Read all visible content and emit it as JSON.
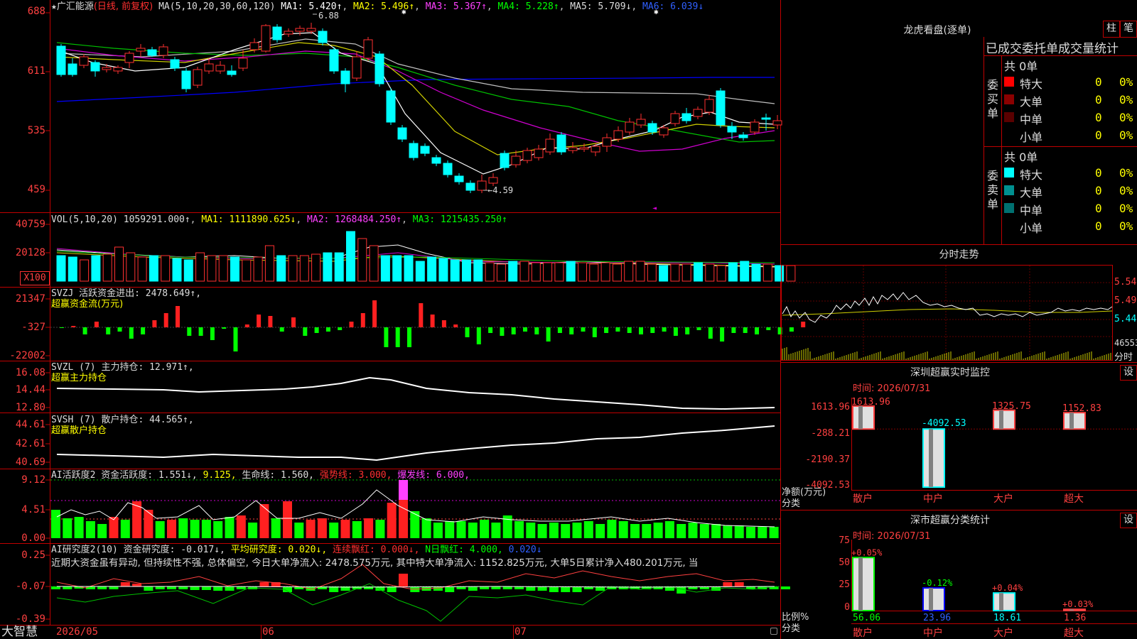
{
  "stock": {
    "star": "★",
    "name": "广汇能源",
    "period": "(日线, 前复权)",
    "ma_label": "MA(5,10,20,30,60,120)",
    "ma1": "MA1: 5.420↑",
    "ma2": "MA2: 5.496↑",
    "ma3": "MA3: 5.367↑",
    "ma4": "MA4: 5.228↑",
    "ma5": "MA5: 5.709↓",
    "ma6": "MA6: 6.039↓",
    "high_marker": "6.88",
    "low_marker": "←4.59"
  },
  "price_axis": [
    "688",
    "611",
    "535",
    "459"
  ],
  "volume": {
    "label": "VOL(5,10,20)",
    "value": "1059291.000↑",
    "ma1": "MA1: 1111890.625↓",
    "ma2": "MA2: 1268484.250↑",
    "ma3": "MA3: 1215435.250↑",
    "axis": [
      "40759",
      "20128"
    ],
    "unit": "X100"
  },
  "svzj": {
    "label": "SVZJ  活跃资金进出: 2478.649↑,",
    "sub": "超赢资金流(万元)",
    "axis": [
      "21347",
      "-327",
      "-22002"
    ]
  },
  "svzl": {
    "label": "SVZL (7) 主力持仓: 12.971↑,",
    "sub": "超赢主力持仓",
    "axis": [
      "16.08",
      "14.44",
      "12.80"
    ]
  },
  "svsh": {
    "label": "SVSH (7) 散户持仓: 44.565↑,",
    "sub": "超赢散户持仓",
    "axis": [
      "44.61",
      "42.61",
      "40.69"
    ]
  },
  "ai_active": {
    "label": "AI活跃度2 资金活跃度: 1.551↓,",
    "v2": "9.125,",
    "life": "生命线: 1.560,",
    "strong": "强势线: 3.000,",
    "burst": "爆发线: 6.000,",
    "axis": [
      "9.12",
      "4.51",
      "0.00"
    ]
  },
  "ai_research": {
    "label": "AI研究度2(10) 资金研究度: -0.017↓,",
    "avg": "平均研究度: 0.020↓,",
    "red": "连续飘红: 0.000↓,",
    "nday": "N日飘红: 4.000,",
    "nval": "0.020↓",
    "comment": "近期大资金虽有异动, 但持续性不强, 总体偏空, 今日大单净流入: 2478.575万元, 其中特大单净流入: 1152.825万元, 大单5日累计净入480.201万元, 当",
    "axis": [
      "0.25",
      "-0.07",
      "-0.39"
    ]
  },
  "bottom": {
    "brand": "大智慧",
    "dates": [
      "2026/05",
      "06",
      "07"
    ]
  },
  "longhu": {
    "title": "龙虎看盘(逐单)",
    "btn_bar": "柱",
    "btn_bi": "笔",
    "header": "已成交委托单成交量统计",
    "buy_label": "委买单",
    "sell_label": "委卖单",
    "buy_total": "共 0单",
    "sell_total": "共 0单",
    "buy_rows": [
      {
        "name": "特大",
        "count": "0",
        "pct": "0%",
        "color": "#ff0000"
      },
      {
        "name": "大单",
        "count": "0",
        "pct": "0%",
        "color": "#8b0000"
      },
      {
        "name": "中单",
        "count": "0",
        "pct": "0%",
        "color": "#5a0000"
      },
      {
        "name": "小单",
        "count": "0",
        "pct": "0%",
        "color": ""
      }
    ],
    "sell_rows": [
      {
        "name": "特大",
        "count": "0",
        "pct": "0%",
        "color": "#00ffff"
      },
      {
        "name": "大单",
        "count": "0",
        "pct": "0%",
        "color": "#009090"
      },
      {
        "name": "中单",
        "count": "0",
        "pct": "0%",
        "color": "#007070"
      },
      {
        "name": "小单",
        "count": "0",
        "pct": "0%",
        "color": ""
      }
    ]
  },
  "fenshi": {
    "title": "分时走势",
    "axis": [
      "5.54",
      "5.49",
      "5.44"
    ],
    "vol": "46553",
    "unit": "分时"
  },
  "sz_monitor": {
    "title": "深圳超赢实时监控",
    "set": "设",
    "time": "时间: 2026/07/31",
    "axis": [
      "1613.96",
      "-288.21",
      "-2190.37",
      "-4092.53"
    ],
    "unit": "净额(万元)",
    "unit2": "分类",
    "bars": [
      {
        "name": "散户",
        "value": 1613.96,
        "label": "1613.96",
        "color": "#ff4040"
      },
      {
        "name": "中户",
        "value": -4092.53,
        "label": "-4092.53",
        "color": "#00ffff"
      },
      {
        "name": "大户",
        "value": 1325.75,
        "label": "1325.75",
        "color": "#ff4040"
      },
      {
        "name": "超大",
        "value": 1152.83,
        "label": "1152.83",
        "color": "#ff4040"
      }
    ]
  },
  "sz_stat": {
    "title": "深市超赢分类统计",
    "set": "设",
    "time": "时间: 2026/07/31",
    "axis": [
      "75",
      "50",
      "25",
      "0"
    ],
    "unit": "比例%",
    "unit2": "分类",
    "bars": [
      {
        "name": "散户",
        "value": 56.06,
        "label": "56.06",
        "chg": "+0.05%",
        "color": "#00ff00",
        "chgcolor": "#ff4040"
      },
      {
        "name": "中户",
        "value": 23.96,
        "label": "23.96",
        "chg": "-0.12%",
        "color": "#0000ff",
        "chgcolor": "#00ff00"
      },
      {
        "name": "大户",
        "value": 18.61,
        "label": "18.61",
        "chg": "+0.04%",
        "color": "#00ffff",
        "chgcolor": "#ff4040"
      },
      {
        "name": "超大",
        "value": 1.36,
        "label": "1.36",
        "chg": "+0.03%",
        "color": "#ff4040",
        "chgcolor": "#ff4040"
      }
    ]
  }
}
